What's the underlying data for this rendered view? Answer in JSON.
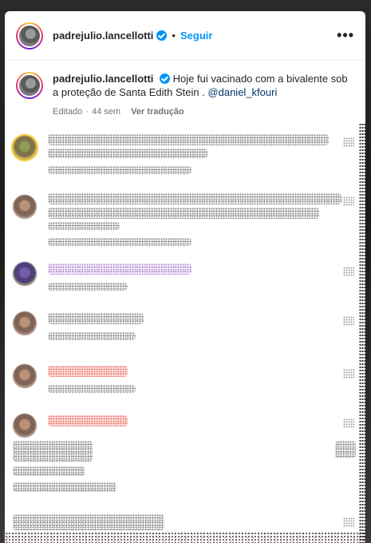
{
  "post": {
    "header": {
      "username": "padrejulio.lancellotti",
      "separator": "•",
      "follow_label": "Seguir",
      "more_label": "•••"
    },
    "caption": {
      "username": "padrejulio.lancellotti",
      "text": "Hoje fui vacinado com a bivalente sob a proteção de Santa Edith Stein . ",
      "mention": "@daniel_kfouri",
      "edited_label": "Editado",
      "separator": "·",
      "time": "44 sem",
      "translate_label": "Ver tradução"
    }
  },
  "colors": {
    "accent": "#0095f6",
    "mention": "#00376b",
    "meta": "#737373"
  },
  "icons": {
    "verified": "verified-badge-icon",
    "more": "more-options-icon"
  }
}
